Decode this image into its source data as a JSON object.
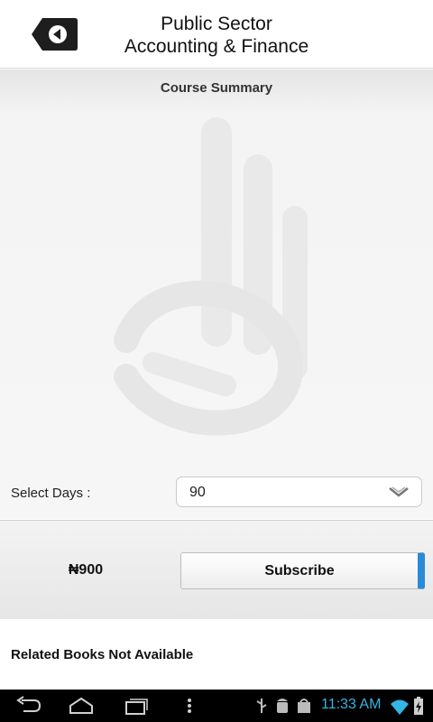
{
  "header": {
    "title_line1": "Public Sector",
    "title_line2": "Accounting & Finance",
    "back_icon": "back-arrow-icon"
  },
  "main": {
    "section_title": "Course Summary",
    "watermark_icon": "ok-hand-logo"
  },
  "selection": {
    "label": "Select Days :",
    "selected_value": "90",
    "dropdown_icon": "chevron-down-icon"
  },
  "subscription": {
    "price": "₦900",
    "button_label": "Subscribe",
    "accent_color": "#2a8ad6"
  },
  "related": {
    "text": "Related Books Not Available"
  },
  "system_bar": {
    "time": "11:33 AM",
    "time_color": "#33b5e5",
    "icons": [
      "back-icon",
      "home-icon",
      "recent-apps-icon",
      "menu-icon",
      "usb-icon",
      "android-debug-icon",
      "shop-icon",
      "wifi-icon",
      "battery-icon"
    ]
  }
}
